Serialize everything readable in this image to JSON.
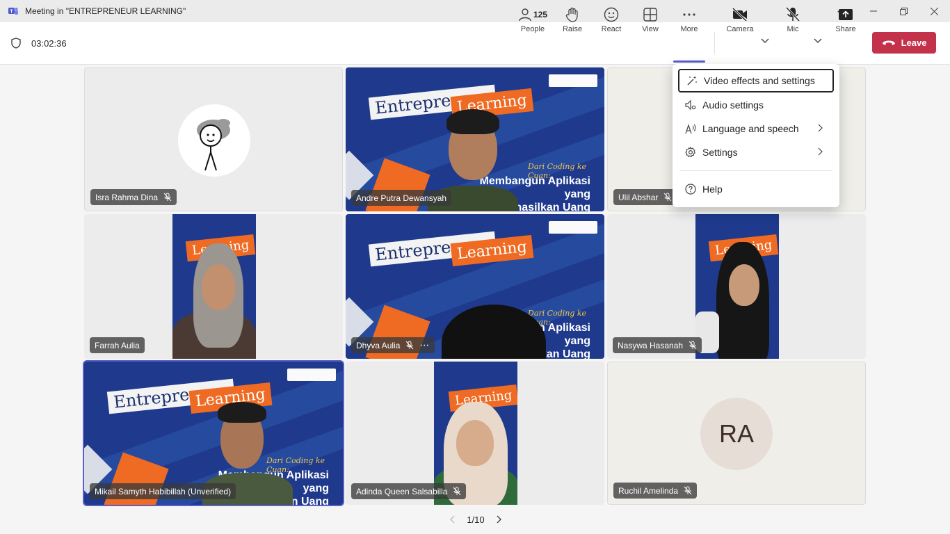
{
  "window": {
    "title": "Meeting in \"ENTREPRENEUR LEARNING\"",
    "more_dots": "⋯"
  },
  "toolbar": {
    "timer": "03:02:36",
    "people_count": "125",
    "people_label": "People",
    "raise_label": "Raise",
    "react_label": "React",
    "view_label": "View",
    "more_label": "More",
    "camera_label": "Camera",
    "mic_label": "Mic",
    "share_label": "Share",
    "leave_label": "Leave"
  },
  "menu": {
    "items": [
      {
        "label": "Video effects and settings",
        "icon": "sparkle-wand-icon"
      },
      {
        "label": "Audio settings",
        "icon": "speaker-settings-icon"
      },
      {
        "label": "Language and speech",
        "icon": "language-speech-icon"
      },
      {
        "label": "Settings",
        "icon": "gear-icon"
      },
      {
        "label": "Help",
        "icon": "help-icon"
      }
    ]
  },
  "banner": {
    "word1": "Entrepreneur",
    "word2": "Learning",
    "subtitle": "Dari Coding ke Cuan:",
    "headline_line1": "Membangun Aplikasi yang",
    "headline_line2": "Menghasilkan Uang"
  },
  "participants": [
    {
      "name": "Isra Rahma Dina",
      "muted": true
    },
    {
      "name": "Andre Putra Dewansyah",
      "muted": false
    },
    {
      "name": "Ulil Abshar",
      "muted": true
    },
    {
      "name": "Farrah Aulia",
      "muted": false
    },
    {
      "name": "Dhyva Aulia",
      "muted": true
    },
    {
      "name": "Nasywa Hasanah",
      "muted": true
    },
    {
      "name": "Mikail Samyth Habibillah (Unverified)",
      "muted": false
    },
    {
      "name": "Adinda Queen Salsabilla",
      "muted": true
    },
    {
      "name": "Ruchil Amelinda",
      "muted": true,
      "initials": "RA"
    }
  ],
  "pager": {
    "text": "1/10"
  },
  "colors": {
    "accent": "#5b5fc7",
    "leave": "#c4314b",
    "banner_blue": "#1f3a8c",
    "banner_orange": "#ef6b23"
  }
}
